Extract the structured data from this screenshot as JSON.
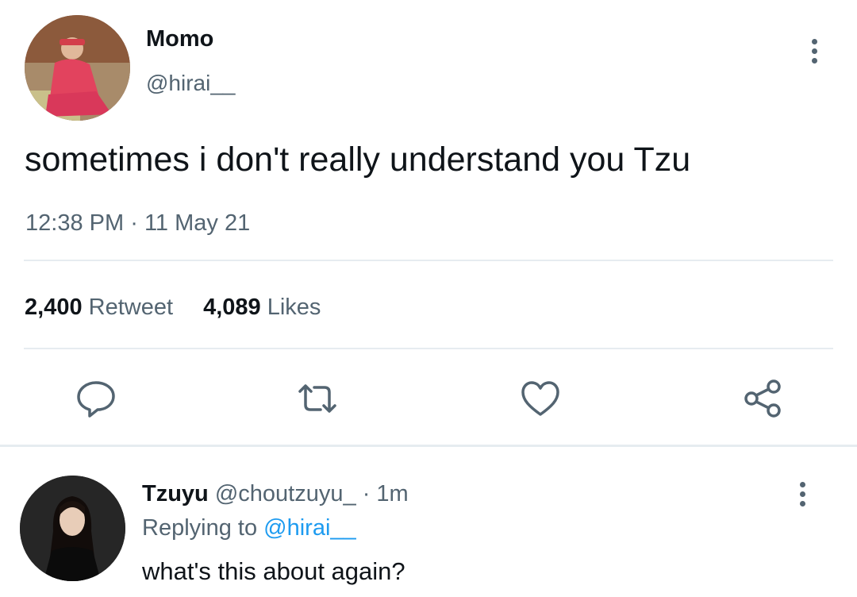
{
  "tweet": {
    "author_name": "Momo",
    "author_handle": "@hirai__",
    "text": "sometimes i don't really understand you Tzu",
    "time": "12:38 PM",
    "dot": "·",
    "date": "11 May 21",
    "retweets": {
      "count": "2,400",
      "label": "Retweet"
    },
    "likes": {
      "count": "4,089",
      "label": "Likes"
    },
    "actions": [
      "reply-icon",
      "retweet-icon",
      "like-icon",
      "share-icon"
    ]
  },
  "reply": {
    "author_name": "Tzuyu",
    "author_handle": "@choutzuyu_",
    "dot": "·",
    "age": "1m",
    "replying_to_prefix": "Replying to",
    "replying_to_handle": "@hirai__",
    "text": "what's this about again?"
  },
  "colors": {
    "text_primary": "#0f1419",
    "text_secondary": "#536471",
    "link": "#1d9bf0",
    "divider": "#e6ecf0"
  }
}
